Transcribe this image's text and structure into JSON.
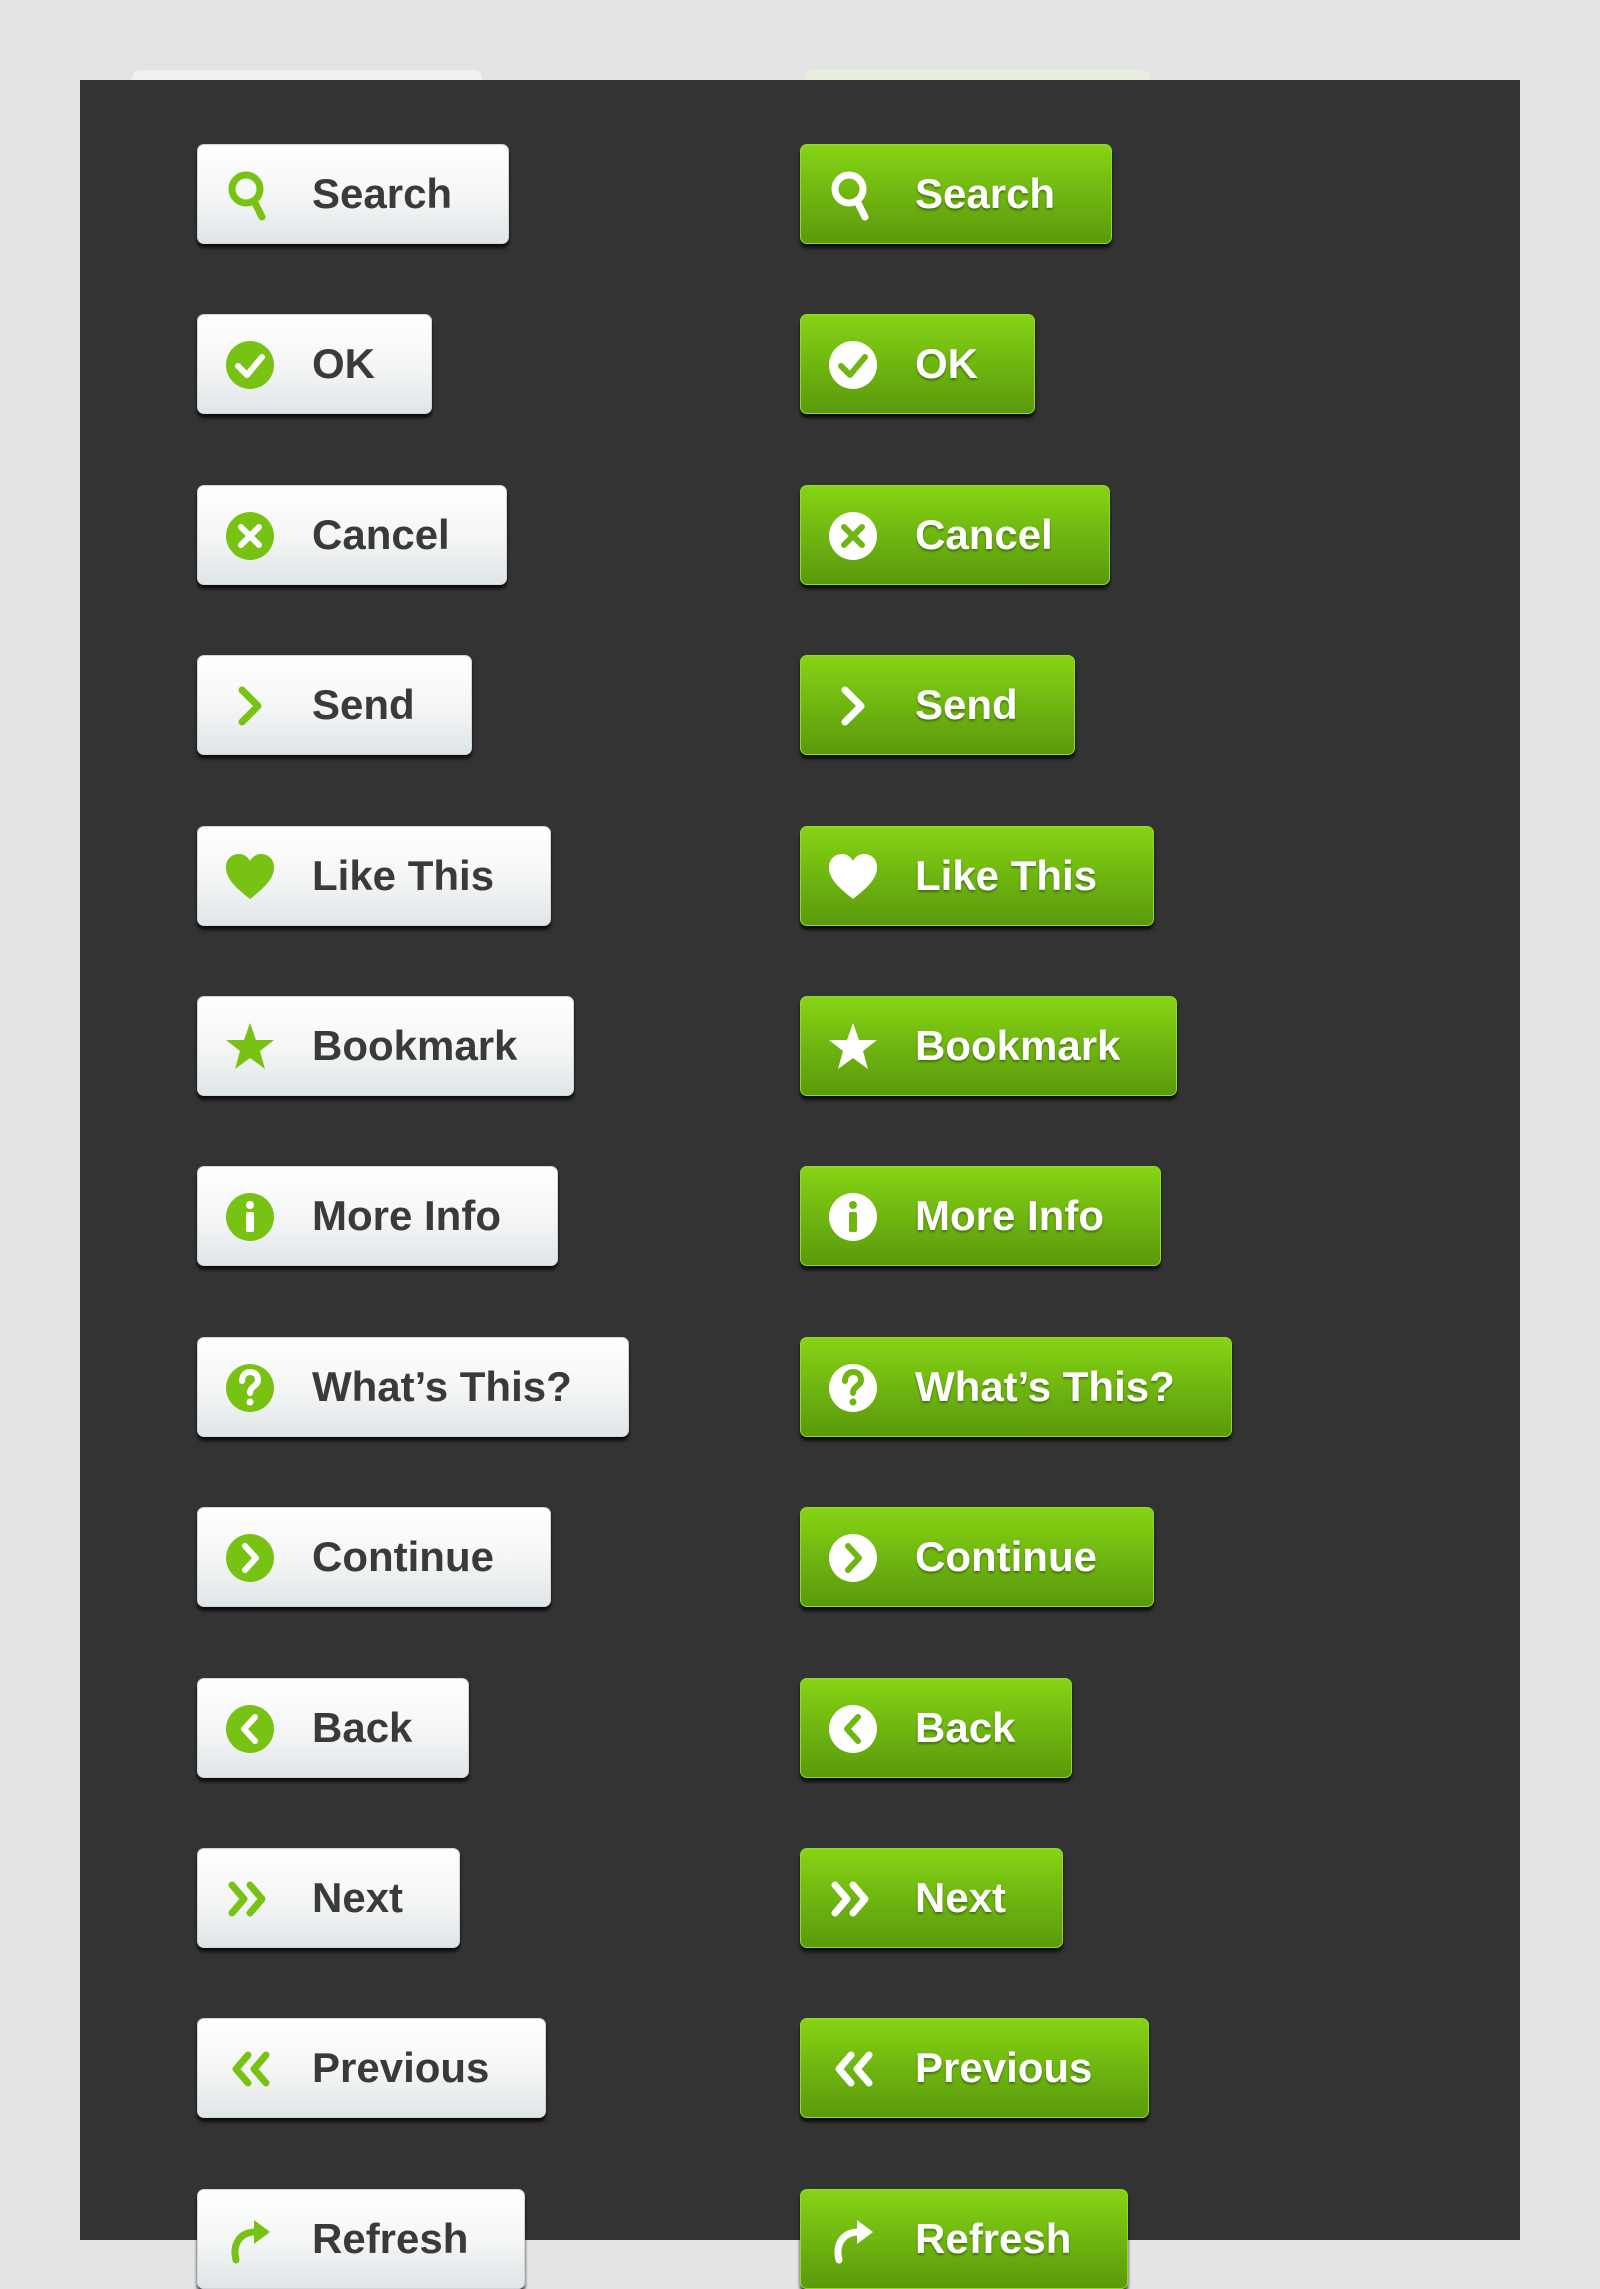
{
  "colors": {
    "background": "#e4e4e4",
    "panel": "#333333",
    "accent": "#78c214",
    "light_text": "#3a3a3a",
    "green_text": "#ffffff"
  },
  "buttons": [
    {
      "label": "Search",
      "icon": "search-icon"
    },
    {
      "label": "OK",
      "icon": "check-circle-icon"
    },
    {
      "label": "Cancel",
      "icon": "x-circle-icon"
    },
    {
      "label": "Send",
      "icon": "chevron-right-icon"
    },
    {
      "label": "Like This",
      "icon": "heart-icon"
    },
    {
      "label": "Bookmark",
      "icon": "star-icon"
    },
    {
      "label": "More Info",
      "icon": "info-circle-icon"
    },
    {
      "label": "What’s This?",
      "icon": "question-circle-icon"
    },
    {
      "label": "Continue",
      "icon": "chevron-right-circle-icon"
    },
    {
      "label": "Back",
      "icon": "chevron-left-circle-icon"
    },
    {
      "label": "Next",
      "icon": "double-chevron-right-icon"
    },
    {
      "label": "Previous",
      "icon": "double-chevron-left-icon"
    },
    {
      "label": "Refresh",
      "icon": "refresh-icon"
    }
  ],
  "variants": [
    "light",
    "green"
  ]
}
